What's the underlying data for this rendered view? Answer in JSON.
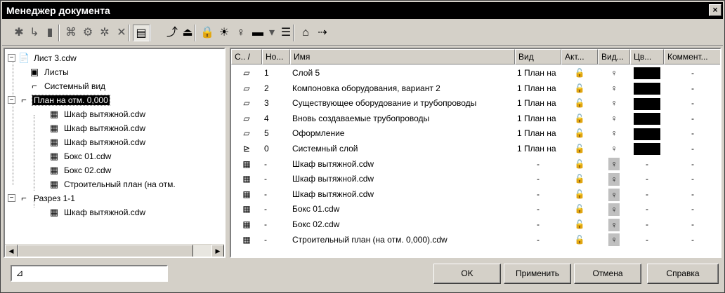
{
  "window": {
    "title": "Менеджер документа",
    "close_glyph": "×"
  },
  "toolbar": {
    "buttons": [
      {
        "icon": "new-sheet-icon",
        "glyph": "✱"
      },
      {
        "icon": "new-view-icon",
        "glyph": "↳"
      },
      {
        "icon": "new-layer-icon",
        "glyph": "▮"
      },
      {
        "icon": "insert-fragment-icon",
        "glyph": "⌘"
      },
      {
        "icon": "insert-view-icon",
        "glyph": "⚙"
      },
      {
        "icon": "properties-icon",
        "glyph": "✲"
      },
      {
        "icon": "delete-icon",
        "glyph": "✕"
      },
      {
        "icon": "layer-list-icon",
        "glyph": "▤"
      },
      {
        "icon": "zoom-icon",
        "glyph": "⤴"
      },
      {
        "icon": "layer-props-icon",
        "glyph": "⏏"
      },
      {
        "icon": "lock-icon",
        "glyph": "🔒"
      },
      {
        "icon": "light-on-icon",
        "glyph": "☀"
      },
      {
        "icon": "light-off-icon",
        "glyph": "♀"
      },
      {
        "icon": "color-icon",
        "glyph": "▬"
      },
      {
        "icon": "color-dropdown-icon",
        "glyph": "▾"
      },
      {
        "icon": "style-icon",
        "glyph": "☰"
      },
      {
        "icon": "export-icon",
        "glyph": "⌂"
      },
      {
        "icon": "import-icon",
        "glyph": "⇢"
      }
    ]
  },
  "tree": {
    "root": "Лист 3.cdw",
    "sheets": "Листы",
    "system_view": "Системный вид",
    "plan_view": "План на отм. 0,000",
    "plan_children": [
      "Шкаф вытяжной.cdw",
      "Шкаф вытяжной.cdw",
      "Шкаф вытяжной.cdw",
      "Бокс 01.cdw",
      "Бокс 02.cdw",
      "Строительный план (на отм."
    ],
    "section": "Разрез 1-1",
    "section_children": [
      "Шкаф вытяжной.cdw"
    ],
    "expanded_glyph": "−",
    "scroll_left": "◀",
    "scroll_right": "▶"
  },
  "grid": {
    "columns": [
      "С.. /",
      "Но...",
      "Имя",
      "Вид",
      "Акт...",
      "Вид...",
      "Цв...",
      "Коммент..."
    ],
    "rows": [
      {
        "kind": "layer",
        "num": "1",
        "name": "Слой 5",
        "view": "1 План на",
        "color": "#000000",
        "comment": "-"
      },
      {
        "kind": "layer",
        "num": "2",
        "name": "Компоновка оборудования, вариант 2",
        "view": "1 План на",
        "color": "#000000",
        "comment": "-"
      },
      {
        "kind": "layer",
        "num": "3",
        "name": "Существующее оборудование и трубопроводы",
        "view": "1 План на",
        "color": "#000000",
        "comment": "-"
      },
      {
        "kind": "layer",
        "num": "4",
        "name": "Вновь создаваемые трубопроводы",
        "view": "1 План на",
        "color": "#000000",
        "comment": "-"
      },
      {
        "kind": "layer",
        "num": "5",
        "name": "Оформление",
        "view": "1 План на",
        "color": "#000000",
        "comment": "-"
      },
      {
        "kind": "system-layer",
        "num": "0",
        "name": "Системный слой",
        "view": "1 План на",
        "color": "#000000",
        "comment": "-"
      },
      {
        "kind": "fragment",
        "num": "-",
        "name": "Шкаф вытяжной.cdw",
        "view": "-",
        "color": "-",
        "comment": "-"
      },
      {
        "kind": "fragment",
        "num": "-",
        "name": "Шкаф вытяжной.cdw",
        "view": "-",
        "color": "-",
        "comment": "-"
      },
      {
        "kind": "fragment",
        "num": "-",
        "name": "Шкаф вытяжной.cdw",
        "view": "-",
        "color": "-",
        "comment": "-"
      },
      {
        "kind": "fragment",
        "num": "-",
        "name": "Бокс 01.cdw",
        "view": "-",
        "color": "-",
        "comment": "-"
      },
      {
        "kind": "fragment",
        "num": "-",
        "name": "Бокс 02.cdw",
        "view": "-",
        "color": "-",
        "comment": "-"
      },
      {
        "kind": "fragment",
        "num": "-",
        "name": "Строительный план (на отм. 0,000).cdw",
        "view": "-",
        "color": "-",
        "comment": "-"
      }
    ],
    "lock_glyph": "🔓",
    "bulb_glyph": "♀"
  },
  "footer": {
    "filter_value": "",
    "ok": "OK",
    "apply": "Применить",
    "cancel": "Отмена",
    "help": "Справка"
  }
}
